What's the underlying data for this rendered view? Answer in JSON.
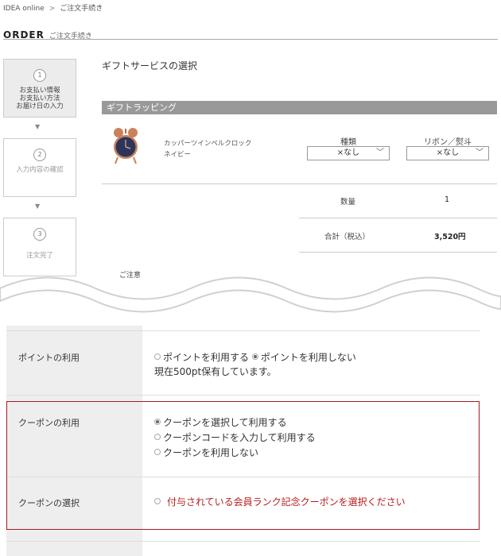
{
  "breadcrumb": {
    "home": "IDEA online",
    "separator": ">",
    "current": "ご注文手続き"
  },
  "header": {
    "title": "ORDER",
    "subtitle": "ご注文手続き"
  },
  "steps": [
    {
      "num": "1",
      "label": "お支払い情報\nお支払い方法\nお届け日の入力"
    },
    {
      "num": "2",
      "label": "入力内容の確認"
    },
    {
      "num": "3",
      "label": "注文完了"
    }
  ],
  "step_arrow": "▼",
  "gift": {
    "section_title": "ギフトサービスの選択",
    "bar_label": "ギフトラッピング",
    "product_name": "カッパーツインベルクロック\nネイビー",
    "type_label": "種類",
    "type_value": "×なし",
    "ribbon_label": "リボン／熨斗",
    "ribbon_value": "×なし",
    "quantity_label": "数量",
    "quantity_value": "1",
    "total_label": "合計（税込）",
    "total_value": "3,520円",
    "notice_label": "ご注意"
  },
  "points": {
    "label": "ポイントの利用",
    "option_use": "ポイントを利用する",
    "option_not_use": "ポイントを利用しない",
    "selected": "not_use",
    "balance": "現在500pt保有しています。"
  },
  "coupon": {
    "label": "クーポンの利用",
    "options": [
      "クーポンを選択して利用する",
      "クーポンコードを入力して利用する",
      "クーポンを利用しない"
    ],
    "selected_index": 0,
    "select_label": "クーポンの選択",
    "select_prompt": "付与されている会員ランク記念クーポンを選択ください"
  },
  "colors": {
    "highlight_border": "#a8191f",
    "prompt_text": "#b71c1c",
    "gift_bar": "#999999"
  }
}
